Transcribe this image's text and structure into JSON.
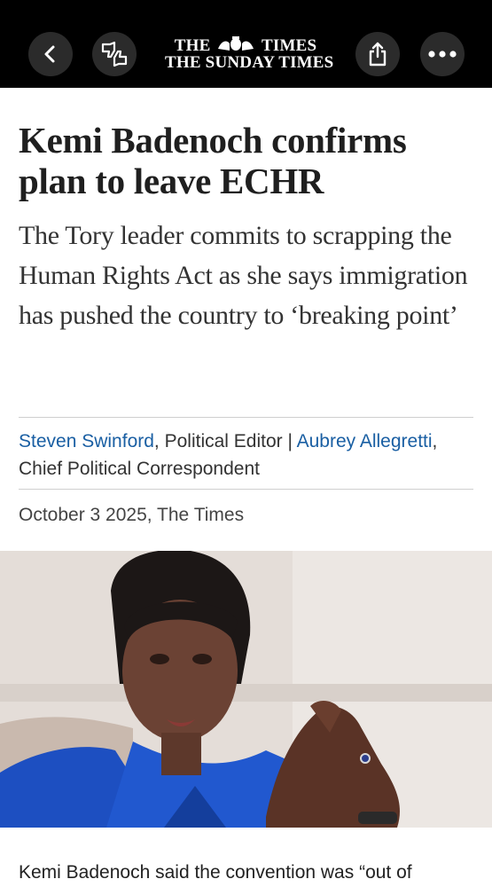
{
  "masthead": {
    "line1_left": "THE",
    "line1_right": "TIMES",
    "line2": "THE SUNDAY TIMES"
  },
  "icons": {
    "back": "chevron-left-icon",
    "reactions": "thumbs-up-down-icon",
    "share": "share-icon",
    "more": "more-horizontal-icon",
    "crest": "royal-crest-icon"
  },
  "article": {
    "headline": "Kemi Badenoch confirms plan to leave ECHR",
    "standfirst": "The Tory leader commits to scrapping the Human Rights Act as she says immigration has pushed the country to ‘breaking point’",
    "byline": {
      "author1": "Steven Swinford",
      "role1": ", Political Editor | ",
      "author2": "Aubrey Allegretti",
      "role2": ", Chief Political Correspondent"
    },
    "dateline": "October 3 2025, The Times",
    "body_first_line": "Kemi Badenoch said the convention was “out of"
  },
  "colors": {
    "topbar": "#000000",
    "link": "#1a5fa3",
    "headline": "#1f1f1f"
  }
}
